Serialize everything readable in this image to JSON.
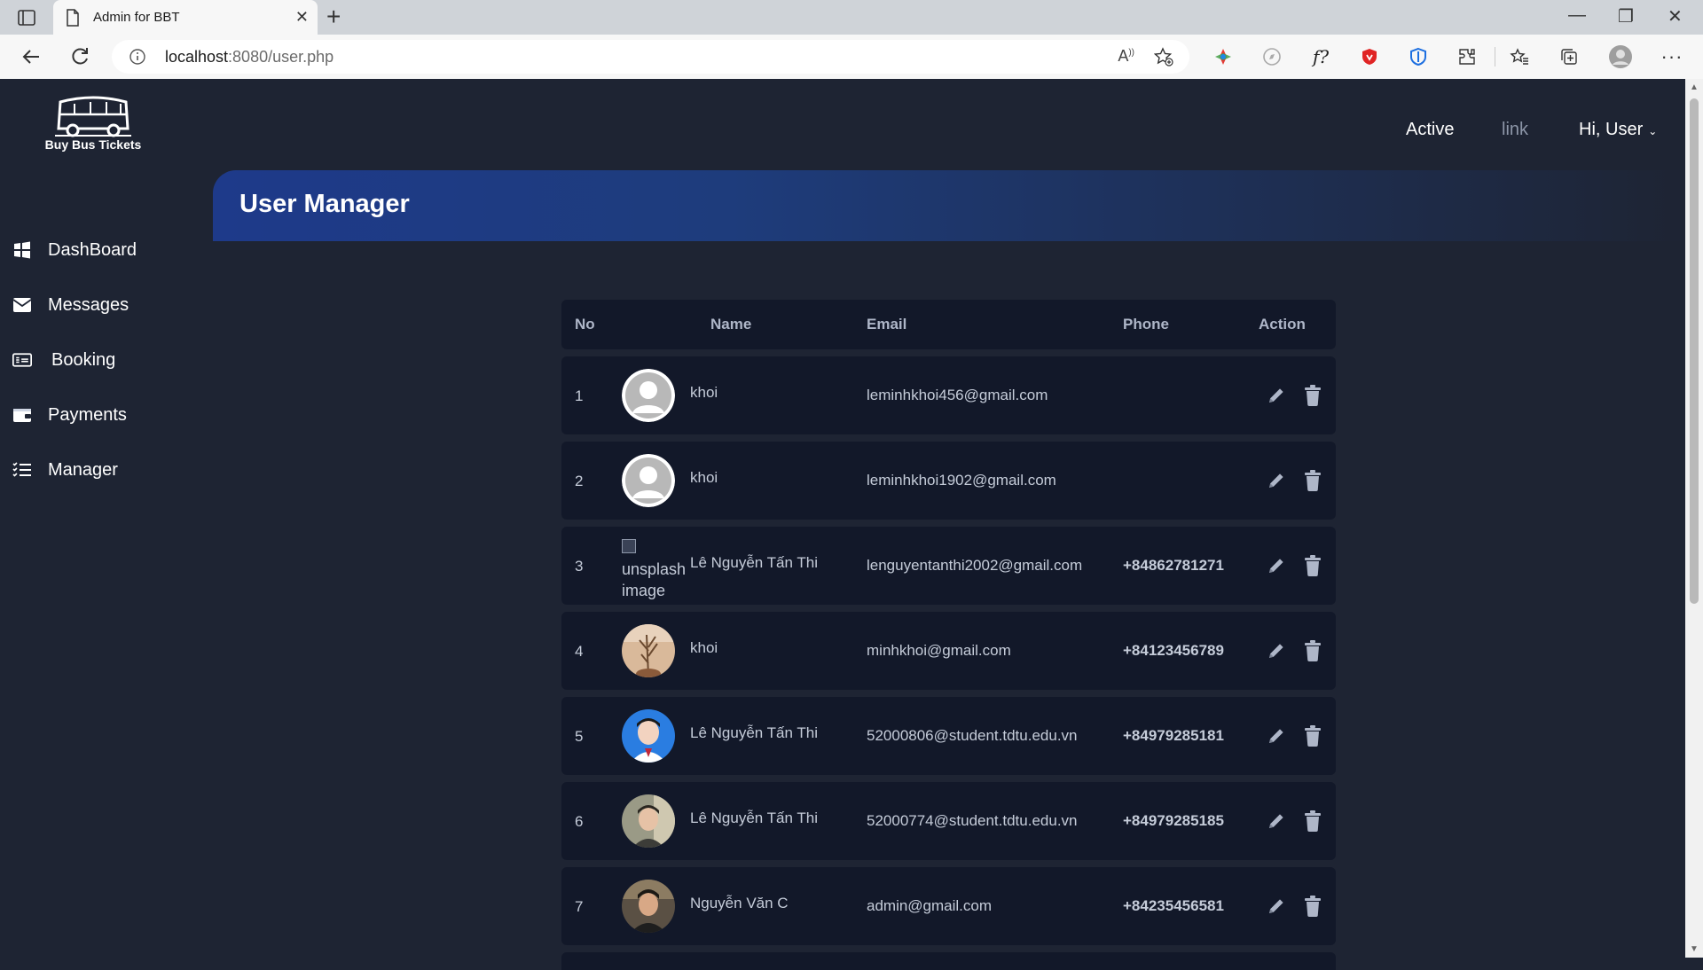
{
  "browser": {
    "tab_title": "Admin for BBT",
    "url_host": "localhost",
    "url_rest": ":8080/user.php"
  },
  "app": {
    "logo_text": "Buy Bus Tickets",
    "topnav": {
      "active": "Active",
      "link": "link",
      "user": "Hi, User"
    },
    "page_title": "User Manager"
  },
  "sidebar": {
    "items": [
      {
        "label": "DashBoard",
        "icon": "dashboard-icon"
      },
      {
        "label": "Messages",
        "icon": "envelope-icon"
      },
      {
        "label": "Booking",
        "icon": "ticket-icon"
      },
      {
        "label": "Payments",
        "icon": "wallet-icon"
      },
      {
        "label": "Manager",
        "icon": "list-icon"
      }
    ]
  },
  "table": {
    "headers": {
      "no": "No",
      "name": "Name",
      "email": "Email",
      "phone": "Phone",
      "action": "Action"
    },
    "rows": [
      {
        "no": "1",
        "name": "khoi",
        "email": "leminhkhoi456@gmail.com",
        "phone": "",
        "avatar": "default"
      },
      {
        "no": "2",
        "name": "khoi",
        "email": "leminhkhoi1902@gmail.com",
        "phone": "",
        "avatar": "default"
      },
      {
        "no": "3",
        "name": "Lê Nguyễn Tấn Thi",
        "email": "lenguyentanthi2002@gmail.com",
        "phone": "+84862781271",
        "avatar": "broken",
        "avatar_alt": "unsplash image"
      },
      {
        "no": "4",
        "name": "khoi",
        "email": "minhkhoi@gmail.com",
        "phone": "+84123456789",
        "avatar": "photo-plant"
      },
      {
        "no": "5",
        "name": "Lê Nguyễn Tấn Thi",
        "email": "52000806@student.tdtu.edu.vn",
        "phone": "+84979285181",
        "avatar": "photo-blue"
      },
      {
        "no": "6",
        "name": "Lê Nguyễn Tấn Thi",
        "email": "52000774@student.tdtu.edu.vn",
        "phone": "+84979285185",
        "avatar": "photo-person"
      },
      {
        "no": "7",
        "name": "Nguyễn Văn C",
        "email": "admin@gmail.com",
        "phone": "+84235456581",
        "avatar": "photo-dark"
      }
    ]
  },
  "colors": {
    "page_bg": "#1e2433",
    "row_bg": "#121829",
    "banner_start": "#1e3a8a"
  }
}
